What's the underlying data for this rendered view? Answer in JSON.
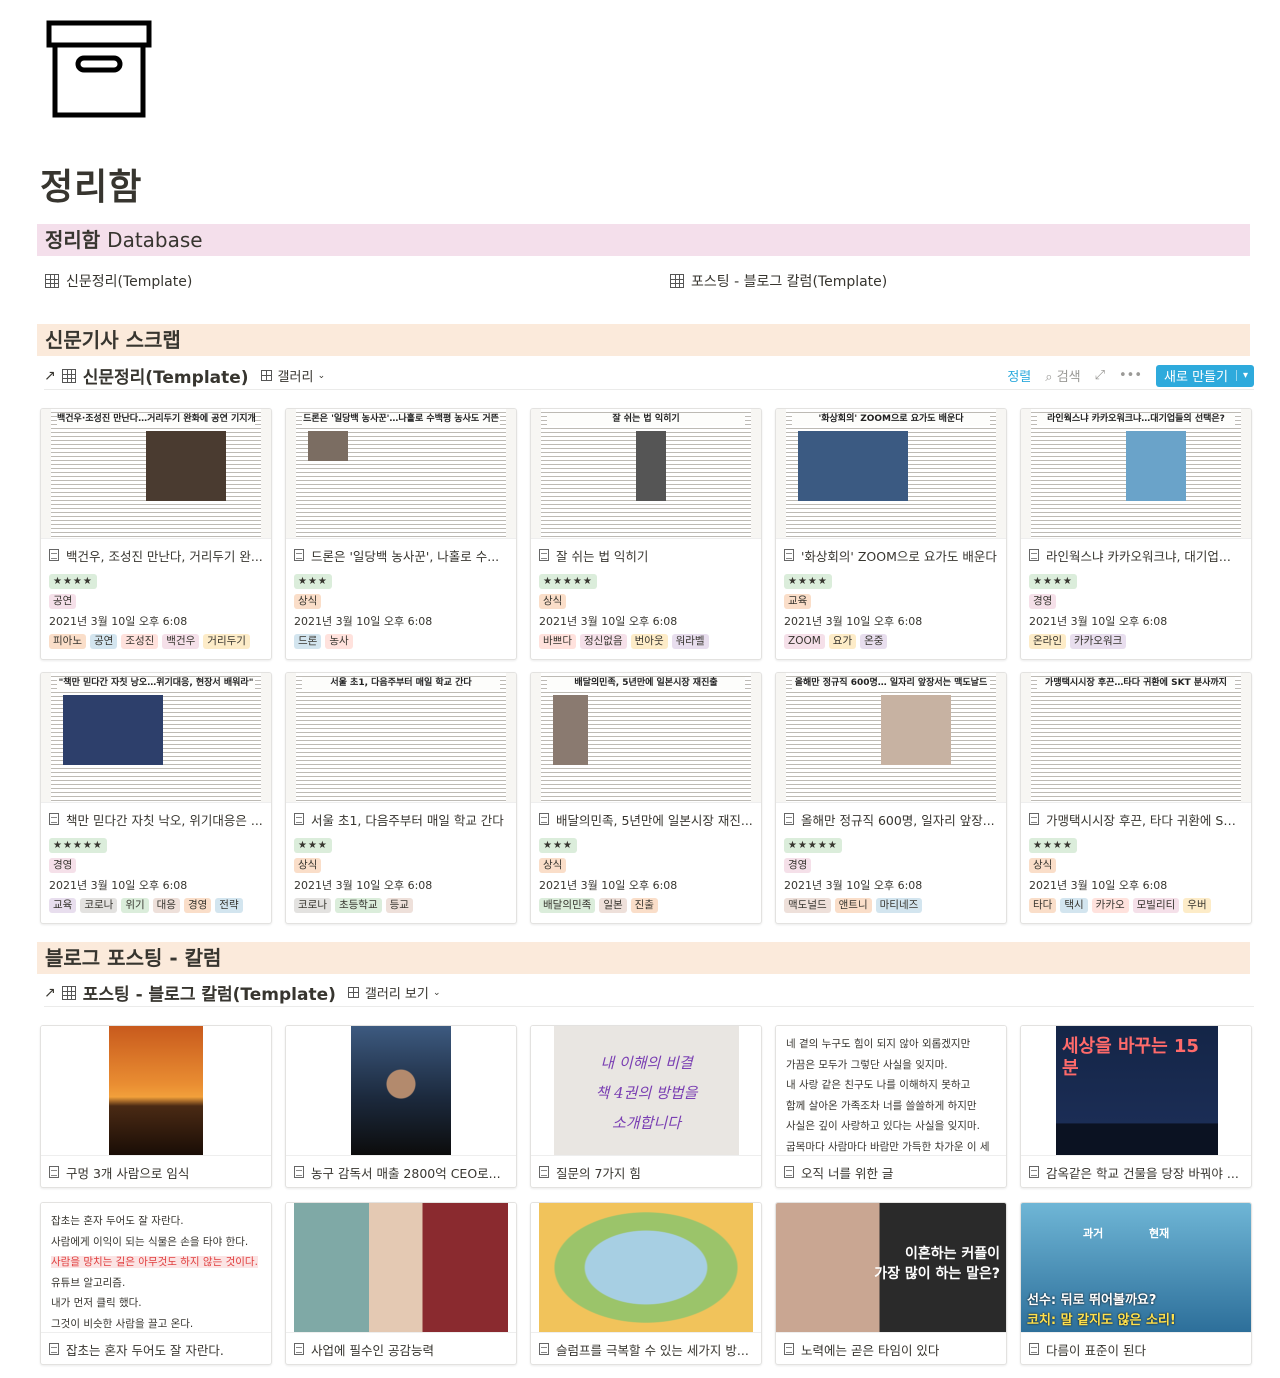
{
  "page": {
    "title": "정리함",
    "icon": "archive-box-icon"
  },
  "database_section": {
    "heading_strong": "정리함",
    "heading_light": "Database",
    "links": [
      {
        "label": "신문정리(Template)",
        "icon": "table-icon"
      },
      {
        "label": "포스팅 - 블로그 칼럼(Template)",
        "icon": "table-icon"
      }
    ]
  },
  "news_section": {
    "heading": "신문기사 스크랩",
    "db_title": "신문정리(Template)",
    "view": "갤러리",
    "actions": {
      "sort": "정렬",
      "search": "검색",
      "new": "새로 만들기"
    },
    "cards": [
      {
        "headline": "백건우·조성진 만난다…거리두기 완화에 공연 기지개",
        "title": "백건우, 조성진 만난다, 거리두기 완...",
        "stars": "★★★★",
        "category": "공연",
        "cat_color": "t-pink",
        "date": "2021년 3월 10일 오후 6:08",
        "tags": [
          "피아노",
          "공연",
          "조성진",
          "백건우",
          "거리두기"
        ]
      },
      {
        "headline": "드론은 '일당백 농사꾼'…나홀로 수백평 농사도 거뜬",
        "title": "드론은 '일당백 농사꾼', 나홀로 수...",
        "stars": "★★★",
        "category": "상식",
        "cat_color": "t-orange",
        "date": "2021년 3월 10일 오후 6:08",
        "tags": [
          "드론",
          "농사"
        ]
      },
      {
        "headline": "잘 쉬는 법 익히기",
        "title": "잘 쉬는 법 익히기",
        "stars": "★★★★★",
        "category": "상식",
        "cat_color": "t-orange",
        "date": "2021년 3월 10일 오후 6:08",
        "tags": [
          "바쁘다",
          "정신없음",
          "번아웃",
          "워라벨"
        ]
      },
      {
        "headline": "'화상회의' ZOOM으로 요가도 배운다",
        "title": "'화상회의' ZOOM으로 요가도 배운다",
        "stars": "★★★★",
        "category": "교육",
        "cat_color": "t-orange",
        "date": "2021년 3월 10일 오후 6:08",
        "tags": [
          "ZOOM",
          "요가",
          "온중"
        ]
      },
      {
        "headline": "라인웍스냐 카카오워크냐…대기업들의 선택은?",
        "title": "라인웍스냐 카카오워크냐, 대기업...",
        "stars": "★★★★",
        "category": "경영",
        "cat_color": "t-pink",
        "date": "2021년 3월 10일 오후 6:08",
        "tags": [
          "온라인",
          "카카오워크"
        ]
      },
      {
        "headline": "\"책만 믿다간 자칫 낭오…위기대응, 현장서 배워라\"",
        "title": "책만 믿다간 자칫 낙오, 위기대응은 ...",
        "stars": "★★★★★",
        "category": "경영",
        "cat_color": "t-pink",
        "date": "2021년 3월 10일 오후 6:08",
        "tags": [
          "교육",
          "코로나",
          "위기",
          "대응",
          "경영",
          "전략"
        ]
      },
      {
        "headline": "서울 초1, 다음주부터 매일 학교 간다",
        "title": "서울 초1, 다음주부터 매일 학교 간다",
        "stars": "★★★",
        "category": "상식",
        "cat_color": "t-orange",
        "date": "2021년 3월 10일 오후 6:08",
        "tags": [
          "코로나",
          "초등학교",
          "등교"
        ]
      },
      {
        "headline": "배달의민족, 5년만에 일본시장 재진출",
        "title": "배달의민족, 5년만에 일본시장 재진...",
        "stars": "★★★",
        "category": "상식",
        "cat_color": "t-orange",
        "date": "2021년 3월 10일 오후 6:08",
        "tags": [
          "배달의민족",
          "일본",
          "진출"
        ]
      },
      {
        "headline": "올해만 정규직 600명… 일자리 앞장서는 맥도날드",
        "title": "올해만 정규직 600명, 일자리 앞장...",
        "stars": "★★★★★",
        "category": "경영",
        "cat_color": "t-pink",
        "date": "2021년 3월 10일 오후 6:08",
        "tags": [
          "맥도널드",
          "앤트니",
          "마티네즈"
        ]
      },
      {
        "headline": "가맹택시시장 후끈…타다 귀환에 SKT 분사까지",
        "title": "가맹택시시장 후끈, 타다 귀환에 SK...",
        "stars": "★★★★",
        "category": "상식",
        "cat_color": "t-orange",
        "date": "2021년 3월 10일 오후 6:08",
        "tags": [
          "타다",
          "택시",
          "카카오",
          "모빌리티",
          "우버"
        ]
      }
    ]
  },
  "blog_section": {
    "heading": "블로그 포스팅 - 칼럼",
    "db_title": "포스팅 - 블로그 칼럼(Template)",
    "view": "갤러리 보기",
    "cards": [
      {
        "title": "구멍 3개 사람으로 임식",
        "thumb": "sunset"
      },
      {
        "title": "농구 감독서 매출 2800억 CEO로... ",
        "thumb": "man"
      },
      {
        "title": "질문의 7가지 힘",
        "thumb": "sign"
      },
      {
        "title": "오직 너를 위한 글",
        "thumb": "text"
      },
      {
        "title": "감옥같은 학교 건물을 당장 바꿔야 ...",
        "thumb": "talk"
      },
      {
        "title": "잡초는 혼자 두어도 잘 자란다.",
        "thumb": "text2"
      },
      {
        "title": "사업에 필수인 공감능력",
        "thumb": "hands"
      },
      {
        "title": "슬럼프를 극복할 수 있는 세가지 방...",
        "thumb": "city"
      },
      {
        "title": "노력에는 곧은 타임이 있다",
        "thumb": "woman"
      },
      {
        "title": "다름이 표준이 된다",
        "thumb": "sports"
      }
    ],
    "text_thumb_1": [
      "네 곁의 누구도 힘이 되지 않아 외롭겠지만",
      "가끔은 모두가 그렇단 사실을 잊지마.",
      "내 사랑 같은 친구도 나를 이해하지 못하고",
      "함께 살아온 가족조차 너를 쓸쓸하게 하지만",
      "사실은 깊이 사랑하고 있다는 사실을 잊지마.",
      "굽목마다 사람마다 바람만 가득한 차가운 이 세"
    ],
    "text_thumb_2": [
      "잡초는 혼자 두어도 잘 자란다.",
      "사람에게 이익이 되는 식물은 손을 타야 한다.",
      "사람을 망치는 길은 아무것도 하지 않는 것이다.",
      "유튜브 알고리즘.",
      "내가 먼저 클릭 했다.",
      "그것이 비슷한 사람을 끌고 온다."
    ],
    "thumb_texts": {
      "sign": [
        "내 이해의 비결",
        "책 4권의 방법을",
        "소개합니다"
      ],
      "talk_big": "세상을 바꾸는 15분",
      "woman_line1": "이혼하는 커플이",
      "woman_line2": "가장 많이 하는 말은?",
      "sports_line1": "선수: 뒤로 뛰어볼까요?",
      "sports_line2": "코치: 말 같지도 않은 소리!",
      "sports_past": "과거",
      "sports_now": "현재"
    }
  }
}
